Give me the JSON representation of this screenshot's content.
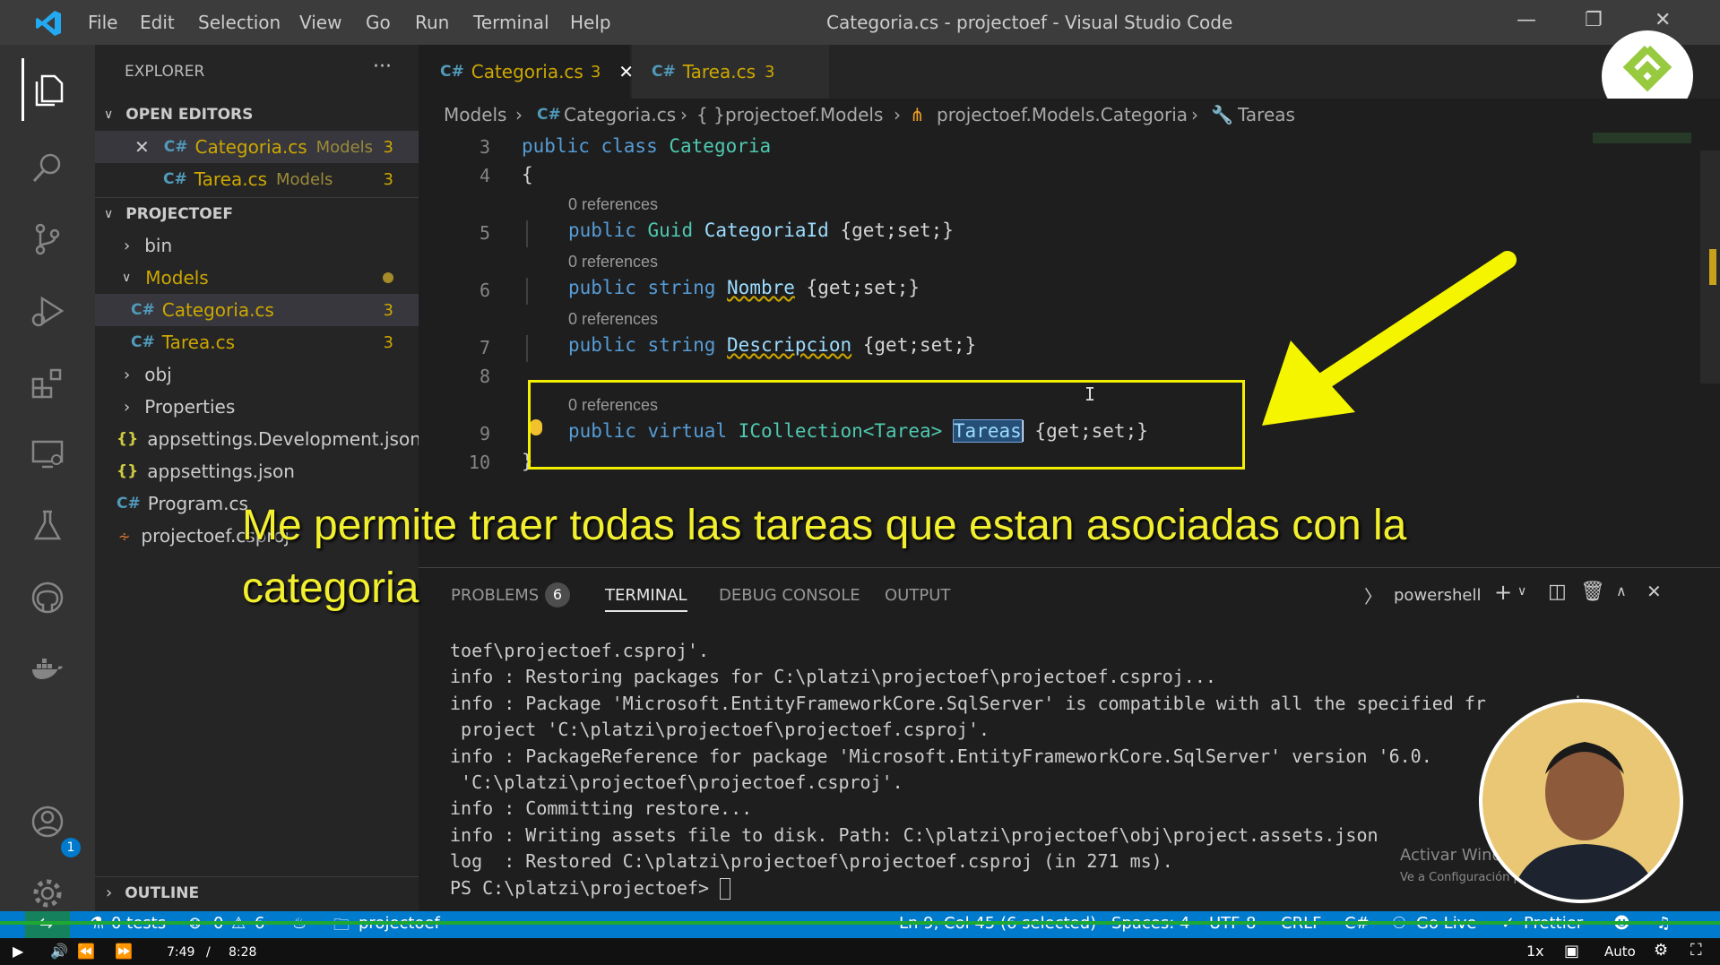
{
  "titlebar": {
    "menus": [
      "File",
      "Edit",
      "Selection",
      "View",
      "Go",
      "Run",
      "Terminal",
      "Help"
    ],
    "title": "Categoria.cs - projectoef - Visual Studio Code"
  },
  "sidebar": {
    "title": "EXPLORER",
    "more": "···",
    "open_editors": "OPEN EDITORS",
    "open_items": [
      {
        "name": "Categoria.cs",
        "folder": "Models",
        "count": "3"
      },
      {
        "name": "Tarea.cs",
        "folder": "Models",
        "count": "3"
      }
    ],
    "project": "PROJECTOEF",
    "tree": {
      "bin": "bin",
      "models": "Models",
      "categoria": "Categoria.cs",
      "categoria_count": "3",
      "tarea": "Tarea.cs",
      "tarea_count": "3",
      "obj": "obj",
      "properties": "Properties",
      "appsettings_dev": "appsettings.Development.json",
      "appsettings": "appsettings.json",
      "program": "Program.cs",
      "csproj": "projectoef.csproj"
    },
    "outline": "OUTLINE",
    "account_badge": "1"
  },
  "tabs": [
    {
      "label": "Categoria.cs",
      "count": "3"
    },
    {
      "label": "Tarea.cs",
      "count": "3"
    }
  ],
  "breadcrumb": {
    "models": "Models",
    "file": "Categoria.cs",
    "ns": "projectoef.Models",
    "cls": "projectoef.Models.Categoria",
    "prop": "Tareas"
  },
  "editor": {
    "lines": [
      "3",
      "4",
      "5",
      "6",
      "7",
      "8",
      "9",
      "10"
    ],
    "refs": "0 references",
    "l3": {
      "kw": "public class",
      "name": "Categoria"
    },
    "l4": "{",
    "l5": {
      "kw": "public",
      "type": "Guid",
      "name": "CategoriaId",
      "acc": "{get;set;}"
    },
    "l6": {
      "kw": "public string",
      "name": "Nombre",
      "acc": "{get;set;}"
    },
    "l7": {
      "kw": "public string",
      "name": "Descripcion",
      "acc": "{get;set;}"
    },
    "l9": {
      "kw": "public virtual",
      "type": "ICollection<Tarea>",
      "name": "Tareas",
      "acc": "{get;set;}"
    },
    "l10": "}"
  },
  "caption": "Me permite traer todas las tareas que estan asociadas con la categoria",
  "panel": {
    "tabs": [
      "PROBLEMS",
      "TERMINAL",
      "DEBUG CONSOLE",
      "OUTPUT"
    ],
    "problems_count": "6",
    "shell": "powershell",
    "terminal_lines": [
      "toef\\projectoef.csproj'.",
      "info : Restoring packages for C:\\platzi\\projectoef\\projectoef.csproj...",
      "info : Package 'Microsoft.EntityFrameworkCore.SqlServer' is compatible with all the specified fr        in",
      " project 'C:\\platzi\\projectoef\\projectoef.csproj'.",
      "info : PackageReference for package 'Microsoft.EntityFrameworkCore.SqlServer' version '6.0.",
      " 'C:\\platzi\\projectoef\\projectoef.csproj'.",
      "info : Committing restore...",
      "info : Writing assets file to disk. Path: C:\\platzi\\projectoef\\obj\\project.assets.json",
      "log  : Restored C:\\platzi\\projectoef\\projectoef.csproj (in 271 ms).",
      "PS C:\\platzi\\projectoef> "
    ],
    "watermark1": "Activar Windows",
    "watermark2": "Ve a Configuración para activar Windows."
  },
  "status": {
    "tests": "0 tests",
    "errors": "0",
    "warnings": "6",
    "folder": "projectoef",
    "position": "Ln 9, Col 45 (6 selected)",
    "spaces": "Spaces: 4",
    "encoding": "UTF-8",
    "eol": "CRLF",
    "lang": "C#",
    "golive": "Go Live",
    "prettier": "Prettier"
  },
  "player": {
    "current": "7:49",
    "sep": "/",
    "total": "8:28",
    "speed": "1x",
    "quality": "Auto"
  },
  "colors": {
    "accent": "#007acc",
    "caption": "#f2ef2e",
    "warning": "#cca700"
  }
}
